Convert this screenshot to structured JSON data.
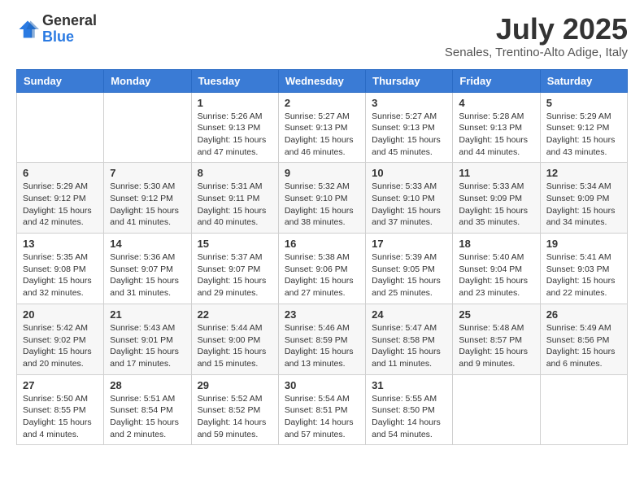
{
  "header": {
    "logo_general": "General",
    "logo_blue": "Blue",
    "month_title": "July 2025",
    "subtitle": "Senales, Trentino-Alto Adige, Italy"
  },
  "weekdays": [
    "Sunday",
    "Monday",
    "Tuesday",
    "Wednesday",
    "Thursday",
    "Friday",
    "Saturday"
  ],
  "weeks": [
    [
      {
        "day": "",
        "info": ""
      },
      {
        "day": "",
        "info": ""
      },
      {
        "day": "1",
        "info": "Sunrise: 5:26 AM\nSunset: 9:13 PM\nDaylight: 15 hours and 47 minutes."
      },
      {
        "day": "2",
        "info": "Sunrise: 5:27 AM\nSunset: 9:13 PM\nDaylight: 15 hours and 46 minutes."
      },
      {
        "day": "3",
        "info": "Sunrise: 5:27 AM\nSunset: 9:13 PM\nDaylight: 15 hours and 45 minutes."
      },
      {
        "day": "4",
        "info": "Sunrise: 5:28 AM\nSunset: 9:13 PM\nDaylight: 15 hours and 44 minutes."
      },
      {
        "day": "5",
        "info": "Sunrise: 5:29 AM\nSunset: 9:12 PM\nDaylight: 15 hours and 43 minutes."
      }
    ],
    [
      {
        "day": "6",
        "info": "Sunrise: 5:29 AM\nSunset: 9:12 PM\nDaylight: 15 hours and 42 minutes."
      },
      {
        "day": "7",
        "info": "Sunrise: 5:30 AM\nSunset: 9:12 PM\nDaylight: 15 hours and 41 minutes."
      },
      {
        "day": "8",
        "info": "Sunrise: 5:31 AM\nSunset: 9:11 PM\nDaylight: 15 hours and 40 minutes."
      },
      {
        "day": "9",
        "info": "Sunrise: 5:32 AM\nSunset: 9:10 PM\nDaylight: 15 hours and 38 minutes."
      },
      {
        "day": "10",
        "info": "Sunrise: 5:33 AM\nSunset: 9:10 PM\nDaylight: 15 hours and 37 minutes."
      },
      {
        "day": "11",
        "info": "Sunrise: 5:33 AM\nSunset: 9:09 PM\nDaylight: 15 hours and 35 minutes."
      },
      {
        "day": "12",
        "info": "Sunrise: 5:34 AM\nSunset: 9:09 PM\nDaylight: 15 hours and 34 minutes."
      }
    ],
    [
      {
        "day": "13",
        "info": "Sunrise: 5:35 AM\nSunset: 9:08 PM\nDaylight: 15 hours and 32 minutes."
      },
      {
        "day": "14",
        "info": "Sunrise: 5:36 AM\nSunset: 9:07 PM\nDaylight: 15 hours and 31 minutes."
      },
      {
        "day": "15",
        "info": "Sunrise: 5:37 AM\nSunset: 9:07 PM\nDaylight: 15 hours and 29 minutes."
      },
      {
        "day": "16",
        "info": "Sunrise: 5:38 AM\nSunset: 9:06 PM\nDaylight: 15 hours and 27 minutes."
      },
      {
        "day": "17",
        "info": "Sunrise: 5:39 AM\nSunset: 9:05 PM\nDaylight: 15 hours and 25 minutes."
      },
      {
        "day": "18",
        "info": "Sunrise: 5:40 AM\nSunset: 9:04 PM\nDaylight: 15 hours and 23 minutes."
      },
      {
        "day": "19",
        "info": "Sunrise: 5:41 AM\nSunset: 9:03 PM\nDaylight: 15 hours and 22 minutes."
      }
    ],
    [
      {
        "day": "20",
        "info": "Sunrise: 5:42 AM\nSunset: 9:02 PM\nDaylight: 15 hours and 20 minutes."
      },
      {
        "day": "21",
        "info": "Sunrise: 5:43 AM\nSunset: 9:01 PM\nDaylight: 15 hours and 17 minutes."
      },
      {
        "day": "22",
        "info": "Sunrise: 5:44 AM\nSunset: 9:00 PM\nDaylight: 15 hours and 15 minutes."
      },
      {
        "day": "23",
        "info": "Sunrise: 5:46 AM\nSunset: 8:59 PM\nDaylight: 15 hours and 13 minutes."
      },
      {
        "day": "24",
        "info": "Sunrise: 5:47 AM\nSunset: 8:58 PM\nDaylight: 15 hours and 11 minutes."
      },
      {
        "day": "25",
        "info": "Sunrise: 5:48 AM\nSunset: 8:57 PM\nDaylight: 15 hours and 9 minutes."
      },
      {
        "day": "26",
        "info": "Sunrise: 5:49 AM\nSunset: 8:56 PM\nDaylight: 15 hours and 6 minutes."
      }
    ],
    [
      {
        "day": "27",
        "info": "Sunrise: 5:50 AM\nSunset: 8:55 PM\nDaylight: 15 hours and 4 minutes."
      },
      {
        "day": "28",
        "info": "Sunrise: 5:51 AM\nSunset: 8:54 PM\nDaylight: 15 hours and 2 minutes."
      },
      {
        "day": "29",
        "info": "Sunrise: 5:52 AM\nSunset: 8:52 PM\nDaylight: 14 hours and 59 minutes."
      },
      {
        "day": "30",
        "info": "Sunrise: 5:54 AM\nSunset: 8:51 PM\nDaylight: 14 hours and 57 minutes."
      },
      {
        "day": "31",
        "info": "Sunrise: 5:55 AM\nSunset: 8:50 PM\nDaylight: 14 hours and 54 minutes."
      },
      {
        "day": "",
        "info": ""
      },
      {
        "day": "",
        "info": ""
      }
    ]
  ]
}
